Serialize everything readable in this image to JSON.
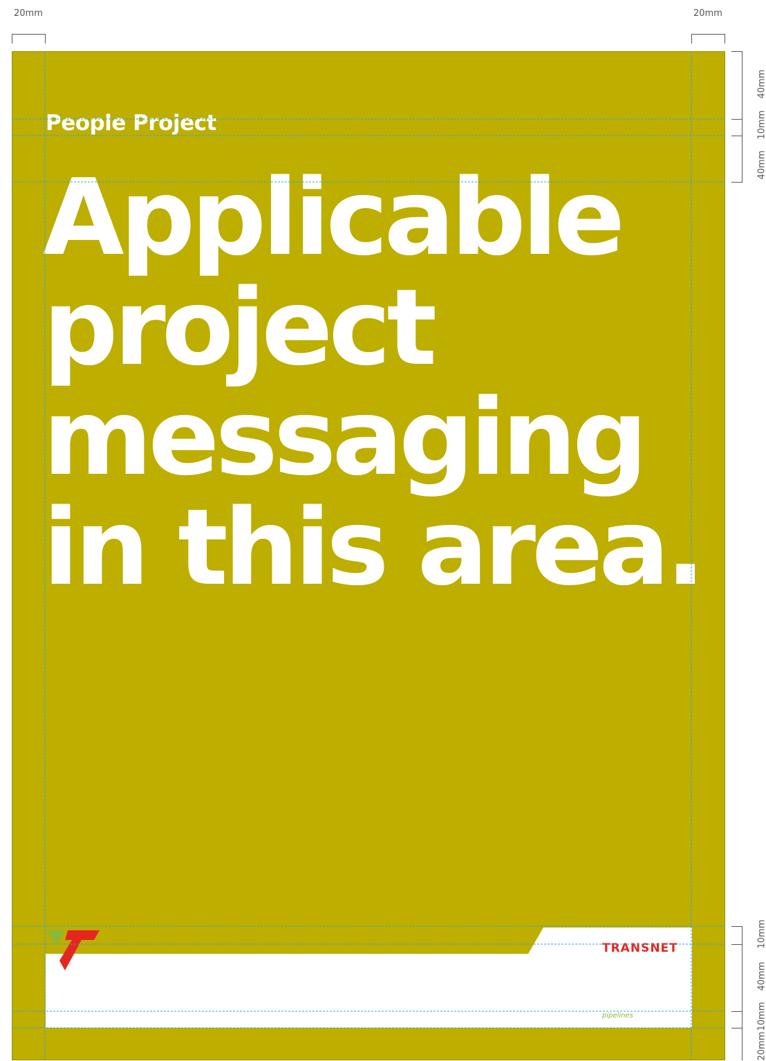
{
  "dimensions": {
    "top_left_margin": "20mm",
    "top_right_margin": "20mm",
    "right_top": [
      "40mm",
      "10mm",
      "40mm"
    ],
    "right_bottom": [
      "10mm",
      "40mm",
      "10mm",
      "20mm"
    ]
  },
  "poster": {
    "kicker": "People Project",
    "headline_lines": [
      "Applicable",
      "project",
      "messaging",
      "in this area."
    ],
    "background_color": "#bdae00"
  },
  "logo": {
    "wordmark": "TRANSNET",
    "subtitle": "pipelines",
    "colors": {
      "red": "#e5261f",
      "green": "#8ab83a"
    }
  }
}
